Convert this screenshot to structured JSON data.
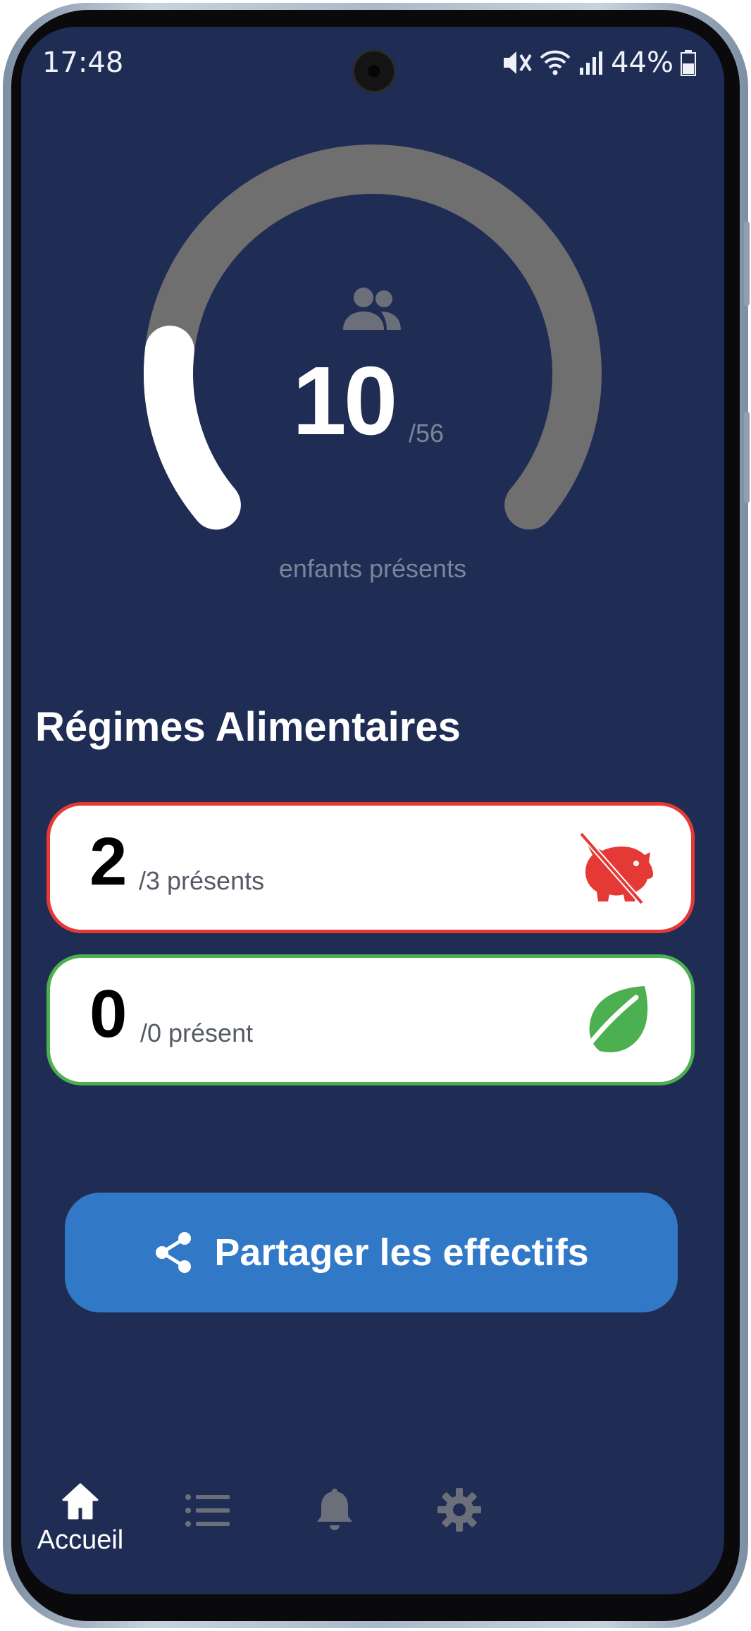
{
  "status_bar": {
    "time": "17:48",
    "battery": "44%",
    "icons": [
      "mute-icon",
      "wifi-icon",
      "signal-icon",
      "battery-icon"
    ]
  },
  "gauge": {
    "present": "10",
    "total": "/56",
    "caption": "enfants présents",
    "fill_fraction": 0.179,
    "icon": "people-icon",
    "colors": {
      "track": "#6f6f6f",
      "fill": "#ffffff"
    }
  },
  "diets": {
    "title": "Régimes Alimentaires",
    "items": [
      {
        "count": "2",
        "label": "/3 présents",
        "icon": "no-pork-icon",
        "color": "#e53935"
      },
      {
        "count": "0",
        "label": "/0 présent",
        "icon": "leaf-icon",
        "color": "#4caf50"
      }
    ]
  },
  "share_button": {
    "label": "Partager les effectifs",
    "icon": "share-icon",
    "color": "#3178c6"
  },
  "bottom_nav": {
    "items": [
      {
        "label": "Accueil",
        "icon": "home-icon",
        "active": true
      },
      {
        "label": "",
        "icon": "list-icon",
        "active": false
      },
      {
        "label": "",
        "icon": "bell-icon",
        "active": false
      },
      {
        "label": "",
        "icon": "gear-icon",
        "active": false
      }
    ]
  },
  "theme": {
    "background": "#1f2c54",
    "inactive_icon": "#6b6f7a"
  }
}
